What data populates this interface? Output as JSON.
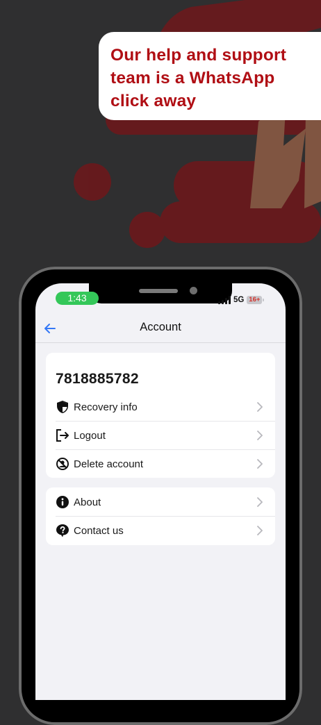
{
  "promo": {
    "headline": "Our help and support\nteam is a WhatsApp\nclick away"
  },
  "status_bar": {
    "time": "1:43",
    "network": "5G",
    "battery": "16+"
  },
  "nav": {
    "title": "Account",
    "back_icon": "arrow-left-icon"
  },
  "account": {
    "phone_number": "7818885782",
    "items": [
      {
        "label": "Recovery info",
        "icon": "shield-icon"
      },
      {
        "label": "Logout",
        "icon": "logout-icon"
      },
      {
        "label": "Delete account",
        "icon": "delete-account-icon"
      }
    ]
  },
  "support": {
    "items": [
      {
        "label": "About",
        "icon": "info-icon"
      },
      {
        "label": "Contact us",
        "icon": "help-icon"
      }
    ]
  },
  "colors": {
    "background": "#2f2f30",
    "brand_red": "#b00e14",
    "accent_blue": "#3478f6",
    "status_green": "#34c759"
  }
}
